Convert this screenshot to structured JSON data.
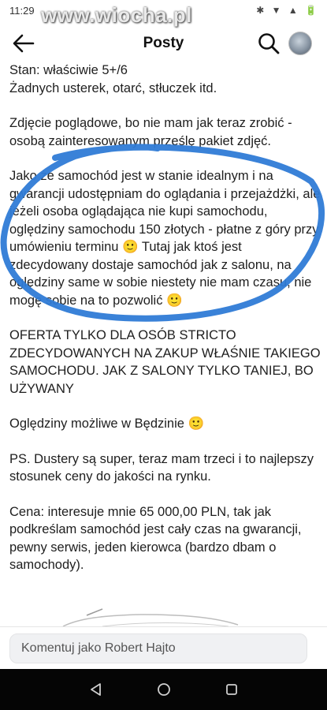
{
  "status_bar": {
    "time": "11:29",
    "icons": "✱ ▼ ▲ 🔋"
  },
  "watermark": "www.wiocha.pl",
  "header": {
    "title": "Posty",
    "back_icon": "arrow-left-icon",
    "search_icon": "search-icon"
  },
  "post": {
    "lines": [
      "Stan: właściwie 5+/6\nŻadnych usterek, otarć, stłuczek itd.",
      "Zdjęcie poglądowe, bo nie mam jak teraz zrobić - osobą zainteresowanym prześlę pakiet zdjęć.",
      "Jako że samochód jest w stanie idealnym i na gwarancji udostępniam do oglądania i przejażdżki, ale jeżeli osoba oglądająca nie kupi samochodu, oględziny samochodu 150 złotych - płatne z góry przy umówieniu terminu 🙂 Tutaj jak ktoś jest zdecydowany dostaje samochód jak z salonu, na oględziny same w sobie niestety nie mam czasu, nie mogę sobie na to pozwolić 🙂",
      "OFERTA TYLKO DLA OSÓB STRICTO ZDECYDOWANYCH NA ZAKUP WŁAŚNIE TAKIEGO SAMOCHODU. JAK Z SALONY TYLKO TANIEJ, BO UŻYWANY",
      "Oględziny możliwe w Będzinie 🙂",
      "PS. Dustery są super, teraz mam trzeci i to najlepszy stosunek ceny do jakości na rynku.",
      "Cena: interesuje mnie 65 000,00 PLN, tak jak podkreślam samochód jest cały czas na gwarancji, pewny serwis, jeden kierowca (bardzo dbam o samochody)."
    ]
  },
  "comment": {
    "placeholder": "Komentuj jako Robert Hajto"
  },
  "colors": {
    "annotation": "#2f7bd6",
    "nav_bar": "#050505",
    "input_bg": "#f0f1f3"
  }
}
